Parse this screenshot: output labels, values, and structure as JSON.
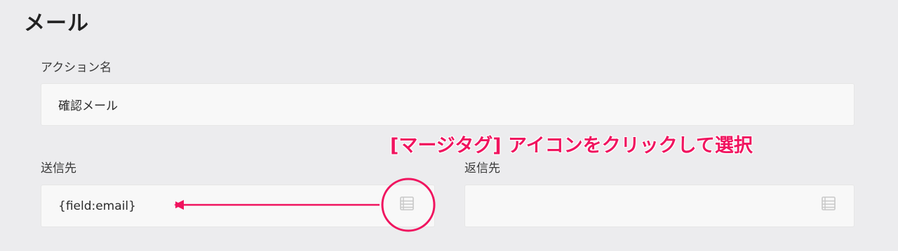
{
  "section": {
    "title": "メール"
  },
  "fields": {
    "action_name": {
      "label": "アクション名",
      "value": "確認メール"
    },
    "to": {
      "label": "送信先",
      "value": "{field:email}"
    },
    "reply_to": {
      "label": "返信先",
      "value": ""
    }
  },
  "annotation": {
    "text": "[マージタグ] アイコンをクリックして選択",
    "color": "#f0145f"
  },
  "icons": {
    "merge_tag": "list-icon"
  }
}
